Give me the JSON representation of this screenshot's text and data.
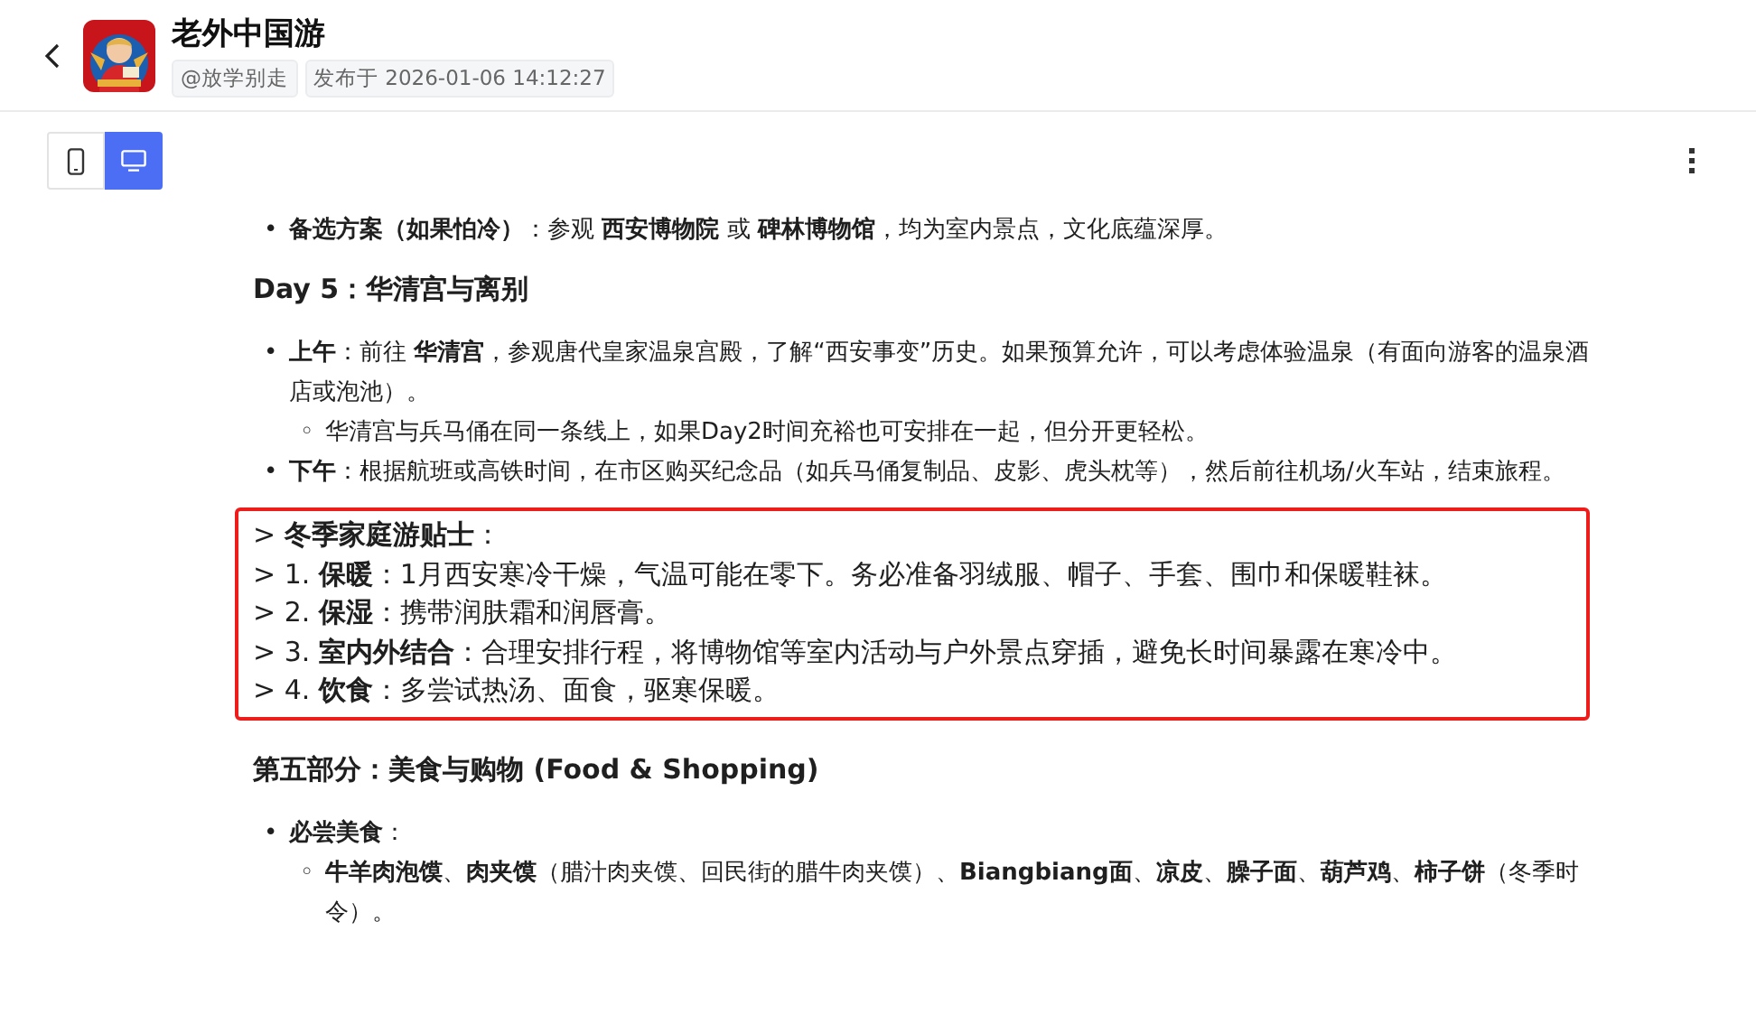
{
  "header": {
    "title": "老外中国游",
    "author": "@放学别走",
    "published": "发布于 2026-01-06 14:12:27"
  },
  "view_toggle": [
    {
      "kind": "mobile",
      "selected": false
    },
    {
      "kind": "desktop",
      "selected": true
    }
  ],
  "content": [
    {
      "kind": "list",
      "items": [
        {
          "marker": "•",
          "text": "**备选方案（如果怕冷）**：参观 **西安博物院** 或 **碑林博物馆**，均为室内景点，文化底蕴深厚。"
        }
      ]
    },
    {
      "kind": "heading",
      "text": "Day 5：华清宫与离别"
    },
    {
      "kind": "list",
      "items": [
        {
          "marker": "•",
          "text": "**上午**：前往 **华清宫**，参观唐代皇家温泉宫殿，了解“西安事变”历史。如果预算允许，可以考虑体验温泉（有面向游客的温泉酒店或泡池）。",
          "children": [
            {
              "marker": "◦",
              "text": "华清宫与兵马俑在同一条线上，如果Day2时间充裕也可安排在一起，但分开更轻松。"
            }
          ]
        },
        {
          "marker": "•",
          "text": "**下午**：根据航班或高铁时间，在市区购买纪念品（如兵马俑复制品、皮影、虎头枕等），然后前往机场/火车站，结束旅程。"
        }
      ]
    },
    {
      "kind": "quote",
      "highlighted": true,
      "lines": [
        "> **冬季家庭游贴士**：",
        "> 1. **保暖**：1月西安寒冷干燥，气温可能在零下。务必准备羽绒服、帽子、手套、围巾和保暖鞋袜。",
        "> 2. **保湿**：携带润肤霜和润唇膏。",
        "> 3. **室内外结合**：合理安排行程，将博物馆等室内活动与户外景点穿插，避免长时间暴露在寒冷中。",
        "> 4. **饮食**：多尝试热汤、面食，驱寒保暖。"
      ]
    },
    {
      "kind": "heading",
      "text": "第五部分：美食与购物 (Food & Shopping)"
    },
    {
      "kind": "list",
      "items": [
        {
          "marker": "•",
          "text": "**必尝美食**：",
          "children": [
            {
              "marker": "◦",
              "text": "**牛羊肉泡馍**、**肉夹馍**（腊汁肉夹馍、回民街的腊牛肉夹馍）、**Biangbiang面**、**凉皮**、**臊子面**、**葫芦鸡**、**柿子饼**（冬季时令）。"
            }
          ]
        }
      ]
    }
  ]
}
